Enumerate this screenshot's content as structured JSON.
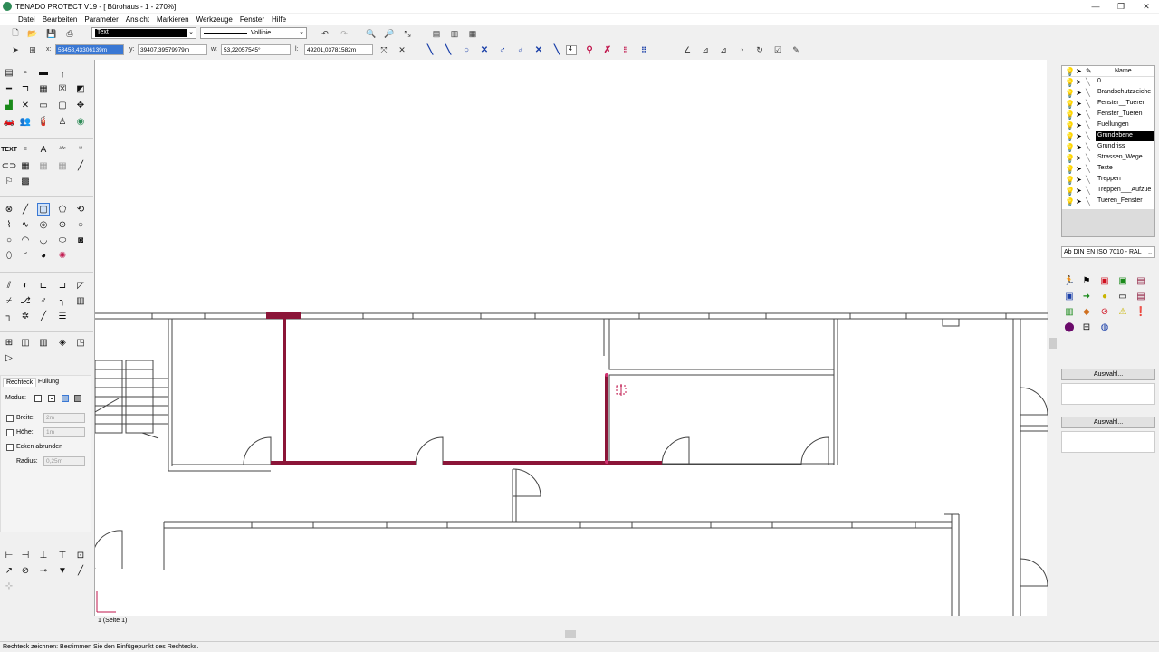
{
  "window": {
    "title": "TENADO PROTECT V19 - [ Bürohaus - 1 - 270%]",
    "controls": [
      "—",
      "❐",
      "✕"
    ]
  },
  "menu": [
    "Datei",
    "Bearbeiten",
    "Parameter",
    "Ansicht",
    "Markieren",
    "Werkzeuge",
    "Fenster",
    "Hilfe"
  ],
  "toolbar": {
    "text_style": "Text",
    "line_type": "Vollinie"
  },
  "coords": {
    "x_label": "x:",
    "x_value": "53458,43306139m",
    "y_label": "y:",
    "y_value": "39407,39579979m",
    "w_label": "w:",
    "w_value": "53,22057545°",
    "l_label": "l:",
    "l_value": "49201,03781582m",
    "snap_value": "4"
  },
  "left_panel": {
    "text_tool": "TEXT",
    "tabs": [
      "Rechteck",
      "Füllung"
    ],
    "mode_label": "Modus:",
    "width_label": "Breite:",
    "width_value": "2m",
    "height_label": "Höhe:",
    "height_value": "1m",
    "round_label": "Ecken abrunden",
    "radius_label": "Radius:",
    "radius_value": "0,25m"
  },
  "page_tab": "1 (Seite 1)",
  "status": "Rechteck zeichnen: Bestimmen Sie den Einfügepunkt des Rechtecks.",
  "layers": {
    "header": "Name",
    "items": [
      "0",
      "Brandschutzzeiche",
      "Fenster__Tueren",
      "Fenster_Tueren",
      "Fuellungen",
      "Grundebene",
      "Grundriss",
      "Strassen_Wege",
      "Texte",
      "Treppen",
      "Treppen___Aufzue",
      "Tueren_Fenster"
    ],
    "active": "Grundebene"
  },
  "symbol_set": "Ab DIN EN ISO 7010 - RAL",
  "buttons": {
    "auswahl1": "Auswahl...",
    "auswahl2": "Auswahl..."
  },
  "colors": {
    "highlight_wall": "#8b1538",
    "snap_blue": "#1a3fa8",
    "layer_bulb": "#c8b400"
  }
}
